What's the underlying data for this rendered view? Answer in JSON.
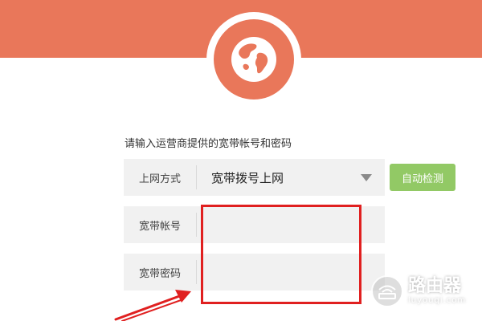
{
  "form": {
    "instruction": "请输入运营商提供的宽带帐号和密码",
    "connection_type": {
      "label": "上网方式",
      "selected": "宽带拨号上网"
    },
    "account": {
      "label": "宽带帐号",
      "value": ""
    },
    "password": {
      "label": "宽带密码",
      "value": ""
    },
    "auto_detect_label": "自动检测"
  },
  "watermark": {
    "title": "路由器",
    "url": "luyouqi.com"
  },
  "colors": {
    "banner": "#e9775a",
    "detect_button": "#92c965",
    "annotation": "#e02020",
    "field_bg": "#f1f1f1"
  },
  "icons": {
    "logo": "globe-icon",
    "dropdown": "dropdown-arrow-icon",
    "watermark": "router-icon"
  }
}
